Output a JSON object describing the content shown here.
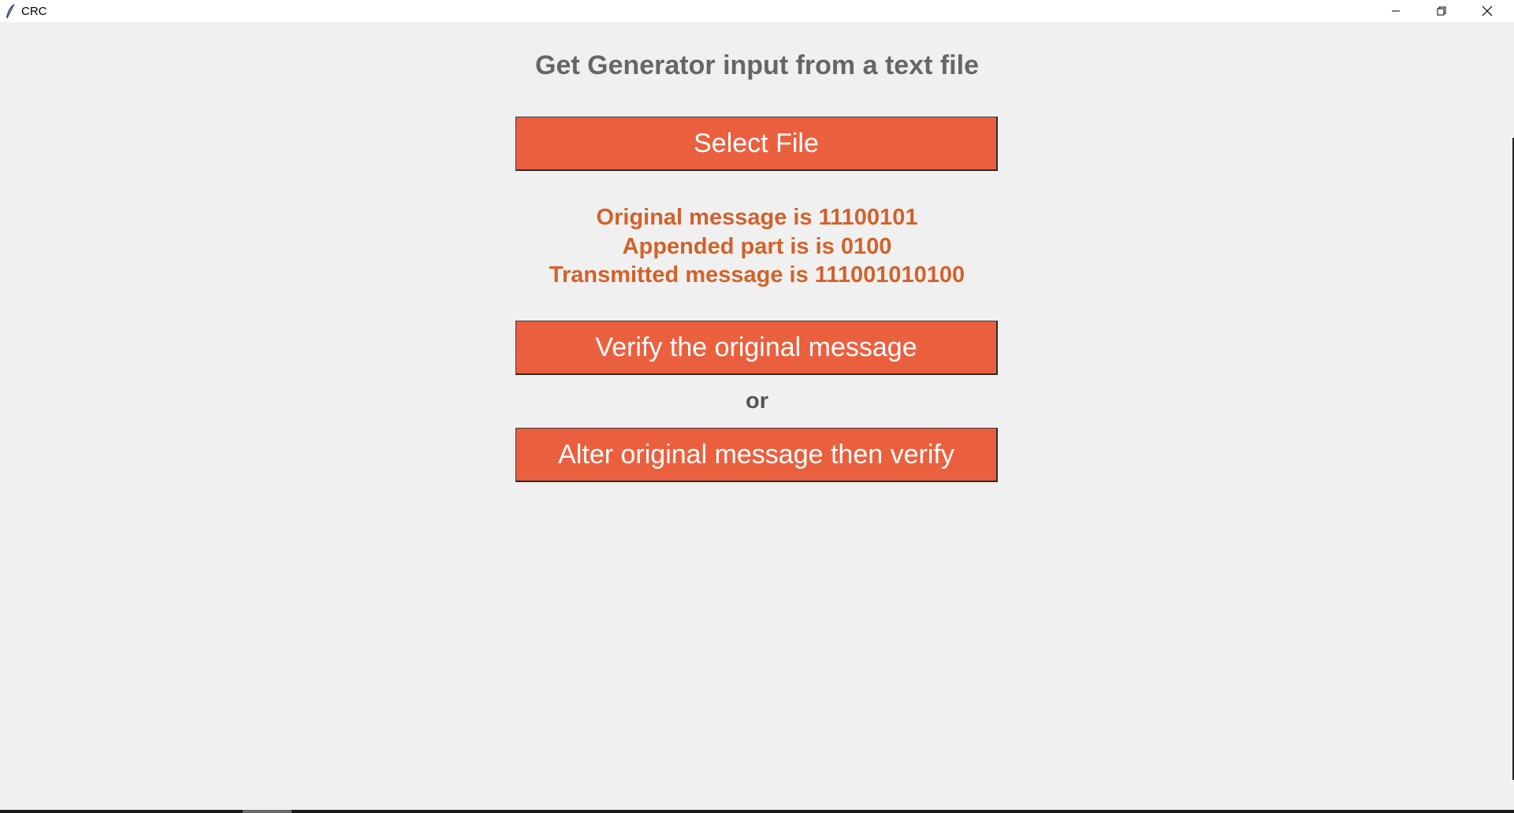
{
  "window": {
    "title": "CRC",
    "icon": "feather-icon",
    "controls": {
      "minimize_icon": "minimize-icon",
      "maximize_icon": "restore-icon",
      "close_icon": "close-icon"
    }
  },
  "main": {
    "heading": "Get Generator input from a text file",
    "select_file_label": "Select File",
    "results": {
      "original": "Original message is 11100101",
      "appended": "Appended part is is 0100",
      "transmitted": "Transmitted message is 111001010100"
    },
    "verify_label": "Verify the original message",
    "or_label": "or",
    "alter_label": "Alter original message then verify"
  },
  "colors": {
    "background": "#f0f0f0",
    "button": "#ea603f",
    "button_text": "#ffffff",
    "heading_text": "#666666",
    "result_text": "#d2622a",
    "or_text": "#555555"
  }
}
